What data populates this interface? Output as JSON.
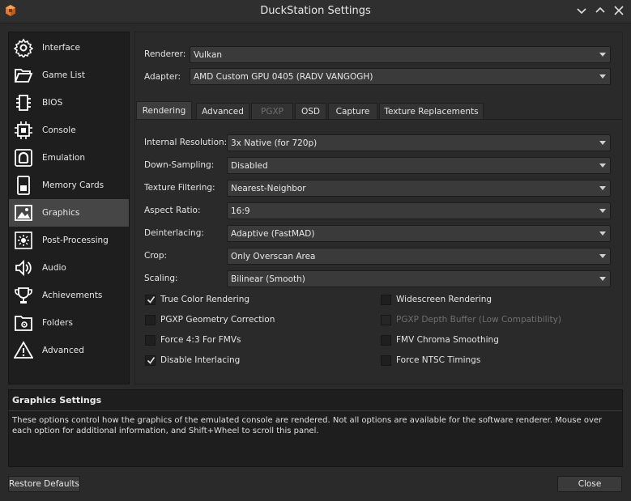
{
  "window": {
    "title": "DuckStation Settings"
  },
  "sidebar": {
    "items": [
      {
        "label": "Interface",
        "icon": "settings-gear-icon"
      },
      {
        "label": "Game List",
        "icon": "folder-open-icon"
      },
      {
        "label": "BIOS",
        "icon": "chip-icon"
      },
      {
        "label": "Console",
        "icon": "cpu-icon"
      },
      {
        "label": "Emulation",
        "icon": "emulation-icon"
      },
      {
        "label": "Memory Cards",
        "icon": "memory-card-icon"
      },
      {
        "label": "Graphics",
        "icon": "image-icon"
      },
      {
        "label": "Post-Processing",
        "icon": "brightness-icon"
      },
      {
        "label": "Audio",
        "icon": "speaker-icon"
      },
      {
        "label": "Achievements",
        "icon": "trophy-icon"
      },
      {
        "label": "Folders",
        "icon": "folder-settings-icon"
      },
      {
        "label": "Advanced",
        "icon": "warning-icon"
      }
    ],
    "active": "Graphics"
  },
  "graphics": {
    "renderer_label": "Renderer:",
    "renderer_value": "Vulkan",
    "adapter_label": "Adapter:",
    "adapter_value": "AMD Custom GPU 0405 (RADV VANGOGH)",
    "tabs": [
      "Rendering",
      "Advanced",
      "PGXP",
      "OSD",
      "Capture",
      "Texture Replacements"
    ],
    "active_tab": "Rendering",
    "settings": [
      {
        "label": "Internal Resolution:",
        "value": "3x Native (for 720p)"
      },
      {
        "label": "Down-Sampling:",
        "value": "Disabled"
      },
      {
        "label": "Texture Filtering:",
        "value": "Nearest-Neighbor"
      },
      {
        "label": "Aspect Ratio:",
        "value": "16:9"
      },
      {
        "label": "Deinterlacing:",
        "value": "Adaptive (FastMAD)"
      },
      {
        "label": "Crop:",
        "value": "Only Overscan Area"
      },
      {
        "label": "Scaling:",
        "value": "Bilinear (Smooth)"
      }
    ],
    "checkboxes_left": [
      {
        "label": "True Color Rendering",
        "checked": true,
        "enabled": true
      },
      {
        "label": "PGXP Geometry Correction",
        "checked": false,
        "enabled": true
      },
      {
        "label": "Force 4:3 For FMVs",
        "checked": false,
        "enabled": true
      },
      {
        "label": "Disable Interlacing",
        "checked": true,
        "enabled": true
      }
    ],
    "checkboxes_right": [
      {
        "label": "Widescreen Rendering",
        "checked": false,
        "enabled": true
      },
      {
        "label": "PGXP Depth Buffer (Low Compatibility)",
        "checked": false,
        "enabled": false
      },
      {
        "label": "FMV Chroma Smoothing",
        "checked": false,
        "enabled": true
      },
      {
        "label": "Force NTSC Timings",
        "checked": false,
        "enabled": true
      }
    ]
  },
  "description": {
    "title": "Graphics Settings",
    "text": "These options control how the graphics of the emulated console are rendered. Not all options are available for the software renderer. Mouse over each option for additional information, and Shift+Wheel to scroll this panel."
  },
  "buttons": {
    "restore_defaults": "Restore Defaults",
    "close": "Close"
  },
  "colors": {
    "background": "#2a2a2a",
    "sidebar_bg": "#1e1e1e",
    "active_item": "#464646",
    "logo_orange": "#e8792b"
  }
}
